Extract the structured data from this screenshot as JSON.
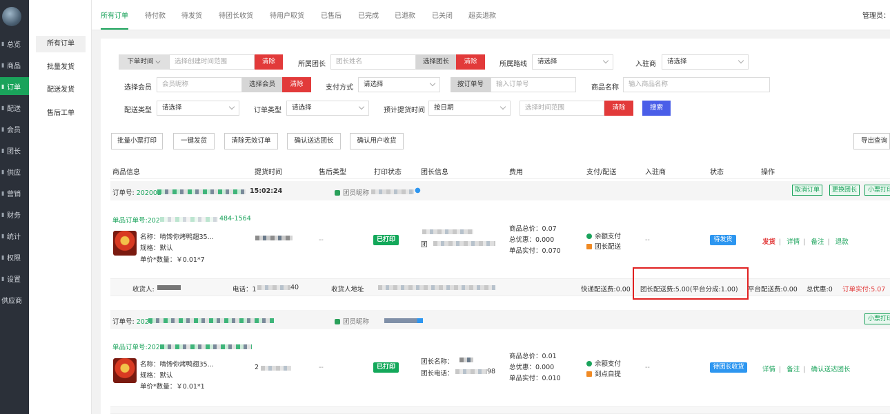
{
  "sidebar": {
    "items": [
      {
        "label": "总览",
        "icon": "dashboard-icon"
      },
      {
        "label": "商品",
        "icon": "goods-icon"
      },
      {
        "label": "订单",
        "icon": "order-icon"
      },
      {
        "label": "配送",
        "icon": "delivery-icon"
      },
      {
        "label": "会员",
        "icon": "member-icon"
      },
      {
        "label": "团长",
        "icon": "leader-icon"
      },
      {
        "label": "供应",
        "icon": "supply-icon"
      },
      {
        "label": "营销",
        "icon": "marketing-icon"
      },
      {
        "label": "财务",
        "icon": "finance-icon"
      },
      {
        "label": "统计",
        "icon": "stats-icon"
      },
      {
        "label": "权限",
        "icon": "permission-icon"
      },
      {
        "label": "设置",
        "icon": "settings-icon"
      },
      {
        "label": "供应商",
        "icon": "supplier-icon"
      }
    ]
  },
  "subnav": {
    "items": [
      "所有订单",
      "批量发货",
      "配送发货",
      "售后工单"
    ]
  },
  "tabs": [
    "所有订单",
    "待付款",
    "待发货",
    "待团长收货",
    "待用户取货",
    "已售后",
    "已完成",
    "已退款",
    "已关闭",
    "超卖退款"
  ],
  "admin_label": "管理员：",
  "filters": {
    "order_time_label": "下单时间",
    "order_time_placeholder": "选择创建时间范围",
    "clear": "清除",
    "leader_label": "所属团长",
    "leader_placeholder": "团长姓名",
    "choose_leader": "选择团长",
    "route_label": "所属路线",
    "select_placeholder": "请选择",
    "merchant_label": "入驻商",
    "member_label": "选择会员",
    "member_placeholder": "会员昵称",
    "choose_member": "选择会员",
    "pay_label": "支付方式",
    "order_no_btn": "按订单号",
    "order_no_placeholder": "输入订单号",
    "goods_label": "商品名称",
    "goods_placeholder": "输入商品名称",
    "delivery_type_label": "配送类型",
    "order_type_label": "订单类型",
    "pickup_time_label": "预计提货时间",
    "by_date": "按日期",
    "time_range_placeholder": "选择时间范围",
    "search": "搜索"
  },
  "actions": [
    "批量小票打印",
    "一键发货",
    "清除无效订单",
    "确认送达团长",
    "确认用户收货"
  ],
  "export_label": "导出查询",
  "columns": [
    "商品信息",
    "提货时间",
    "售后类型",
    "打印状态",
    "团长信息",
    "费用",
    "支付/配送",
    "入驻商",
    "状态",
    "操作"
  ],
  "orders": [
    {
      "order_no_label": "订单号: ",
      "order_no_prefix": "202002",
      "time": "15:02:24",
      "member_label": "团员昵称",
      "top_tags": [
        "取消订单",
        "更换团长",
        "小票打印"
      ],
      "sub_no_label": "单品订单号:",
      "sub_no_prefix": "202",
      "sub_no_suffix": "484-1564",
      "goods_name": "名称：啃馋你烤鸭翅35...",
      "spec": "规格：默认",
      "price_qty": "单价*数量：￥0.01*7",
      "after_sale": "--",
      "print_status": "已打印",
      "leader_prefix": "团",
      "fee_total": "商品总价：0.07",
      "fee_discount": "总优惠：0.000",
      "fee_actual": "单品实付：0.070",
      "pay": "余额支付",
      "delivery": "团长配送",
      "merchant": "--",
      "status": "待发货",
      "ops": [
        "发货",
        "详情",
        "备注",
        "退款"
      ],
      "receiver_label": "收货人:",
      "phone_label": "电话：1",
      "phone_suffix": "40",
      "address_label": "收货人地址",
      "express_fee": "快递配送费:0.00",
      "leader_fee": "团长配送费:5.00(平台分成:1.00)",
      "platform_fee": "平台配送费:0.00",
      "total_discount": "总优惠:0",
      "order_paid": "订单实付:5.07"
    },
    {
      "order_no_label": "订单号: ",
      "order_no_prefix": "2020",
      "member_label": "团员昵称",
      "top_tags": [
        "小票打印"
      ],
      "sub_no_label": "单品订单号:",
      "sub_no_prefix": "202",
      "goods_name": "名称：啃馋你烤鸭翅35...",
      "spec": "规格：默认",
      "price_qty": "单价*数量：￥0.01*1",
      "pickup_prefix": "2",
      "after_sale": "--",
      "print_status": "已打印",
      "leader_name_label": "团长名称：",
      "leader_phone_label": "团长电话：",
      "leader_phone_suffix": "98",
      "fee_total": "商品总价：0.01",
      "fee_discount": "总优惠：0.000",
      "fee_actual": "单品实付：0.010",
      "pay": "余额支付",
      "delivery": "到点自提",
      "merchant": "--",
      "status": "待团长收货",
      "ops": [
        "详情",
        "备注",
        "确认送达团长"
      ]
    }
  ],
  "colors": {
    "accent": "#1aa35b",
    "danger": "#e23a3a",
    "primary": "#4a5ee8",
    "sidebar": "#2b3039",
    "status_blue": "#2d96f0"
  }
}
